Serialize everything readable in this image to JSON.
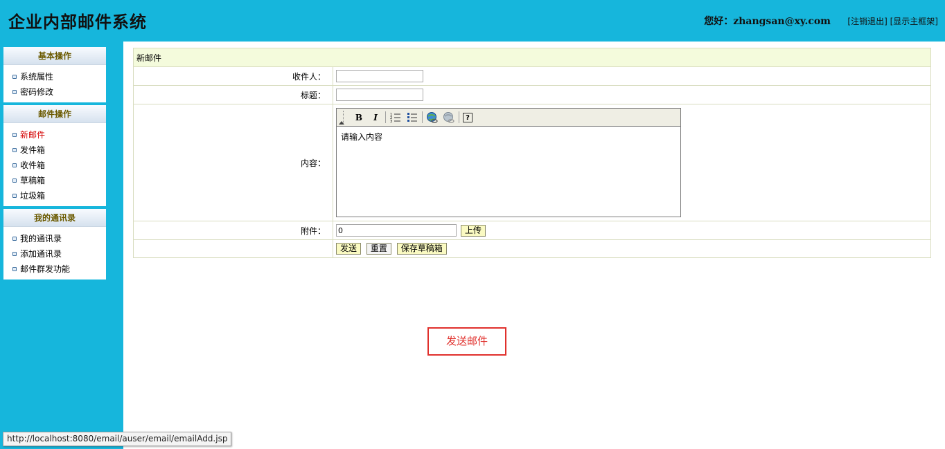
{
  "header": {
    "title": "企业内部邮件系统",
    "greeting": "您好：zhangsan@xy.com",
    "logout_link": "[注销退出]",
    "main_frame_link": "[显示主框架]"
  },
  "sidebar": {
    "groups": [
      {
        "title": "基本操作",
        "items": [
          {
            "label": "系统属性"
          },
          {
            "label": "密码修改"
          }
        ]
      },
      {
        "title": "邮件操作",
        "items": [
          {
            "label": "新邮件"
          },
          {
            "label": "发件箱"
          },
          {
            "label": "收件箱"
          },
          {
            "label": "草稿箱"
          },
          {
            "label": "垃圾箱"
          }
        ]
      },
      {
        "title": "我的通讯录",
        "items": [
          {
            "label": "我的通讯录"
          },
          {
            "label": "添加通讯录"
          },
          {
            "label": "邮件群发功能"
          }
        ]
      }
    ],
    "active_item": "新邮件"
  },
  "form": {
    "heading": "新邮件",
    "recipient_label": "收件人：",
    "recipient_value": "",
    "subject_label": "标题：",
    "subject_value": "",
    "content_label": "内容：",
    "content_value": "请输入内容",
    "attachment_label": "附件：",
    "attachment_value": "0",
    "upload_button": "上传",
    "send_button": "发送",
    "reset_button": "重置",
    "save_draft_button": "保存草稿箱",
    "toolbar": {
      "bold_label": "B",
      "italic_label": "I",
      "help_label": "?"
    }
  },
  "callout_label": "发送邮件",
  "status_bar_url": "http://localhost:8080/email/auser/email/emailAdd.jsp",
  "colors": {
    "frame_blue": "#16b6dc",
    "form_header_bg": "#f4fbdc",
    "button_bg": "#fafac2",
    "active_menu": "#d40000",
    "callout_red": "#e0302c"
  }
}
